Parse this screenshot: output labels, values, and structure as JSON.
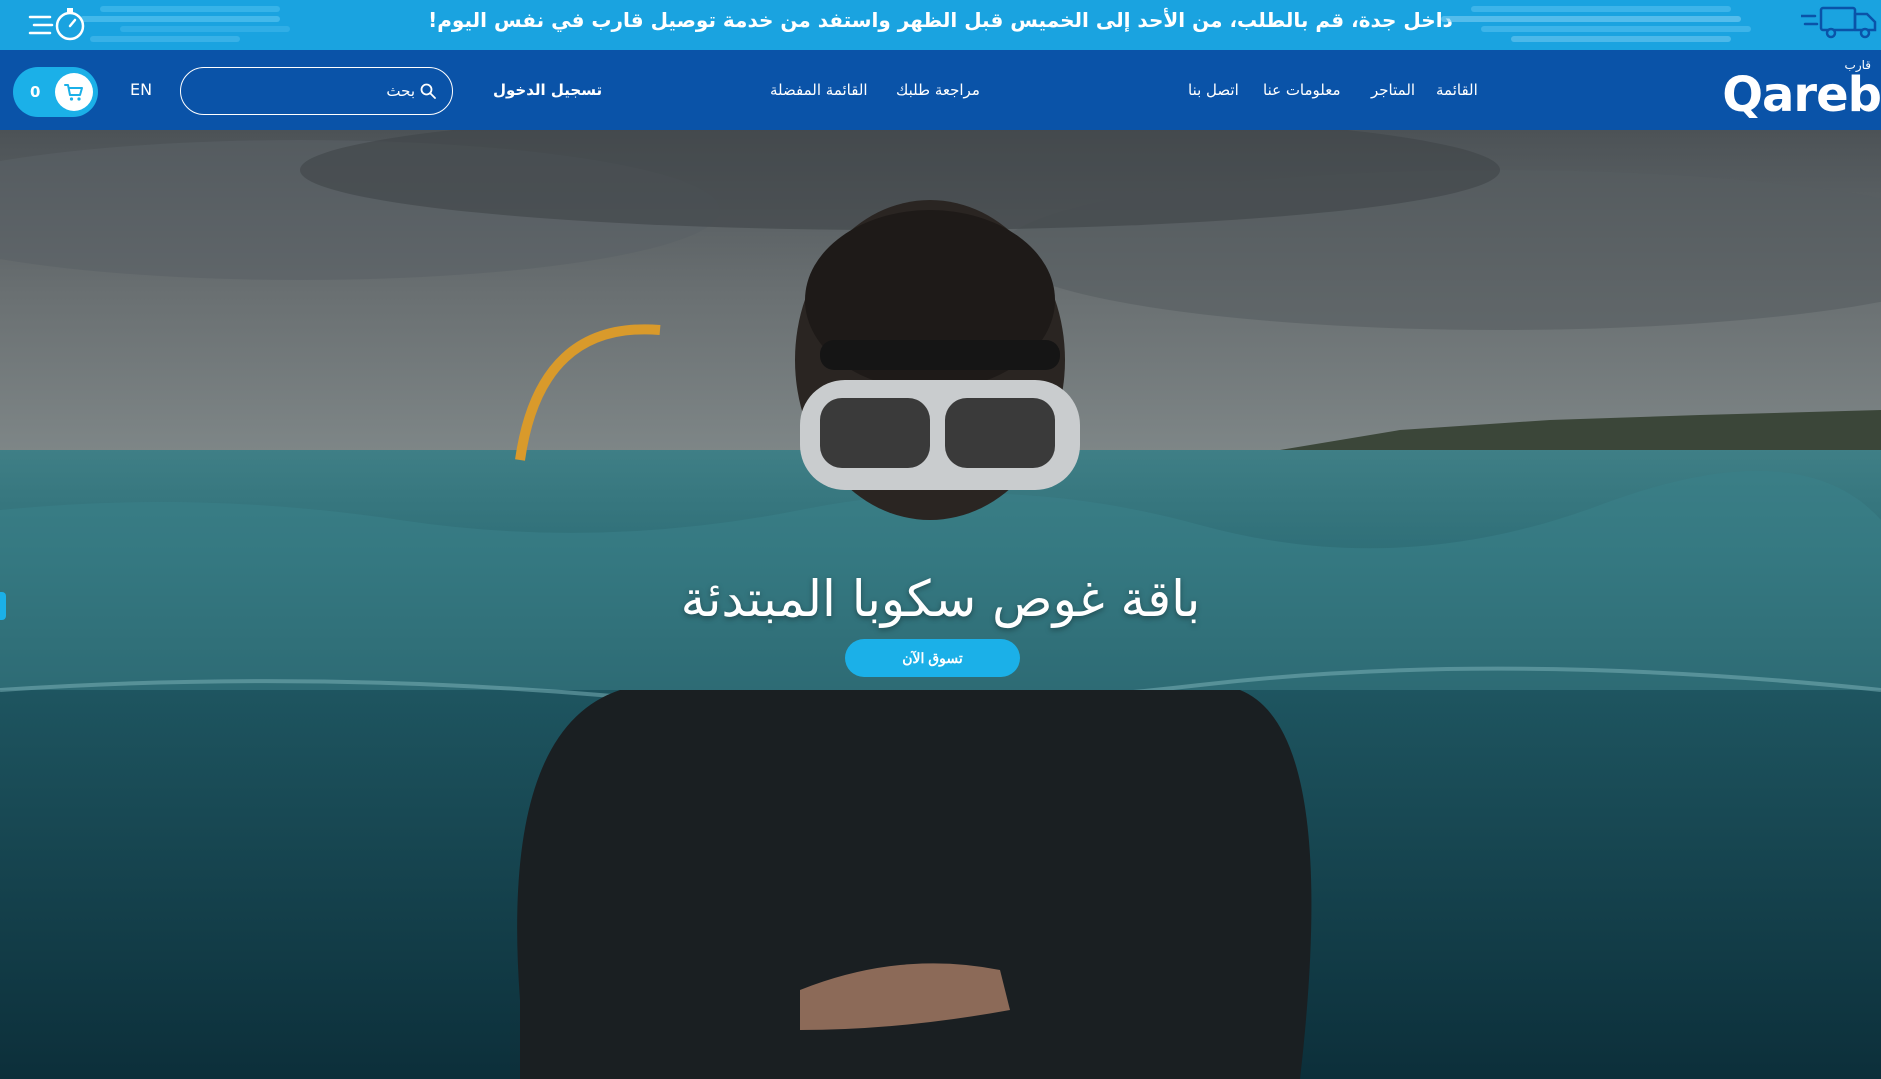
{
  "announcement": {
    "text": "داخل جدة، قم بالطلب، من الأحد إلى الخميس قبل الظهر واستفد من خدمة توصيل قارب في نفس اليوم!"
  },
  "navbar": {
    "cart_count": "0",
    "language_label": "EN",
    "search_placeholder": "بحث",
    "login_label": "تسجيل الدخول",
    "links": [
      {
        "label": "مراجعة طلبك"
      },
      {
        "label": "القائمة المفضلة"
      },
      {
        "label": "اتصل بنا"
      },
      {
        "label": "معلومات عنا"
      },
      {
        "label": "المتاجر"
      },
      {
        "label": "القائمة"
      }
    ],
    "logo_text": "Qareb",
    "logo_arabic": "قارب"
  },
  "hero": {
    "title": "باقة غوص سكوبا المبتدئة",
    "cta_label": "تسوق الآن"
  },
  "colors": {
    "announcement_bg": "#1aa3e0",
    "navbar_bg": "#0a53a8",
    "accent": "#1bb0e8"
  }
}
